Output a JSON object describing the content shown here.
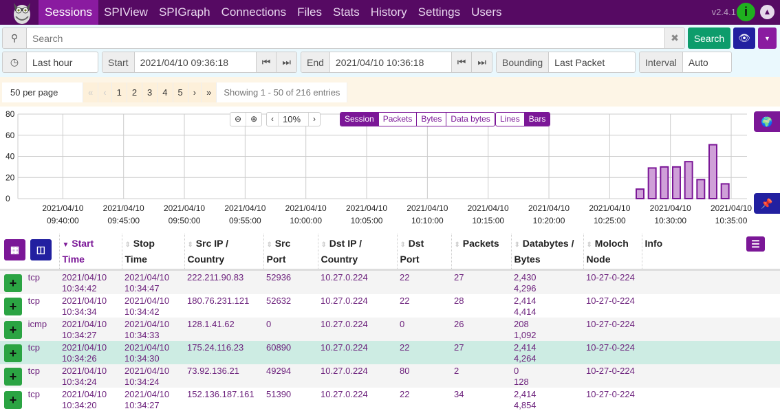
{
  "nav": {
    "items": [
      "Sessions",
      "SPIView",
      "SPIGraph",
      "Connections",
      "Files",
      "Stats",
      "History",
      "Settings",
      "Users"
    ],
    "active": "Sessions",
    "version": "v2.4.1"
  },
  "search": {
    "placeholder": "Search",
    "button": "Search"
  },
  "time": {
    "range": "Last hour",
    "start_label": "Start",
    "start": "2021/04/10 09:36:18",
    "end_label": "End",
    "end": "2021/04/10 10:36:18",
    "bounding_label": "Bounding",
    "bounding": "Last Packet",
    "interval_label": "Interval",
    "interval": "Auto"
  },
  "pager": {
    "per_page": "50 per page",
    "first": "«",
    "prev": "‹",
    "pages": [
      "1",
      "2",
      "3",
      "4",
      "5"
    ],
    "next": "›",
    "last": "»",
    "showing": "Showing 1 - 50 of 216 entries"
  },
  "chart_toolbar": {
    "zoom": "10%",
    "types": [
      "Session",
      "Packets",
      "Bytes",
      "Data bytes"
    ],
    "active_type": "Session",
    "styles": [
      "Lines",
      "Bars"
    ],
    "active_style": "Bars"
  },
  "chart_data": {
    "type": "bar",
    "xlim": [
      "09:36:18",
      "10:36:18"
    ],
    "ylim": [
      0,
      80
    ],
    "yticks": [
      0,
      20,
      40,
      60,
      80
    ],
    "grid": true,
    "xticks": [
      {
        "t": "09:40",
        "date": "2021/04/10",
        "time": "09:40:00"
      },
      {
        "t": "09:45",
        "date": "2021/04/10",
        "time": "09:45:00"
      },
      {
        "t": "09:50",
        "date": "2021/04/10",
        "time": "09:50:00"
      },
      {
        "t": "09:55",
        "date": "2021/04/10",
        "time": "09:55:00"
      },
      {
        "t": "10:00",
        "date": "2021/04/10",
        "time": "10:00:00"
      },
      {
        "t": "10:05",
        "date": "2021/04/10",
        "time": "10:05:00"
      },
      {
        "t": "10:10",
        "date": "2021/04/10",
        "time": "10:10:00"
      },
      {
        "t": "10:15",
        "date": "2021/04/10",
        "time": "10:15:00"
      },
      {
        "t": "10:20",
        "date": "2021/04/10",
        "time": "10:20:00"
      },
      {
        "t": "10:25",
        "date": "2021/04/10",
        "time": "10:25:00"
      },
      {
        "t": "10:30",
        "date": "2021/04/10",
        "time": "10:30:00"
      },
      {
        "t": "10:35",
        "date": "2021/04/10",
        "time": "10:35:00"
      }
    ],
    "x": [
      "10:27",
      "10:28",
      "10:29",
      "10:30",
      "10:31",
      "10:32",
      "10:33",
      "10:34"
    ],
    "values": [
      9,
      29,
      30,
      30,
      35,
      18,
      51,
      14
    ],
    "color": "#7b1797"
  },
  "table": {
    "headers": [
      [
        "Start",
        "Time"
      ],
      [
        "Stop",
        "Time"
      ],
      [
        "Src IP /",
        "Country"
      ],
      [
        "Src",
        "Port"
      ],
      [
        "Dst IP /",
        "Country"
      ],
      [
        "Dst",
        "Port"
      ],
      [
        "Packets",
        ""
      ],
      [
        "Databytes /",
        "Bytes"
      ],
      [
        "Moloch",
        "Node"
      ],
      [
        "Info",
        ""
      ]
    ],
    "rows": [
      [
        "tcp",
        "2021/04/10",
        "10:34:42",
        "2021/04/10",
        "10:34:47",
        "222.211.90.83",
        "52936",
        "10.27.0.224",
        "22",
        "27",
        "2,430",
        "4,296",
        "10-27-0-224"
      ],
      [
        "tcp",
        "2021/04/10",
        "10:34:34",
        "2021/04/10",
        "10:34:42",
        "180.76.231.121",
        "52632",
        "10.27.0.224",
        "22",
        "28",
        "2,414",
        "4,414",
        "10-27-0-224"
      ],
      [
        "icmp",
        "2021/04/10",
        "10:34:27",
        "2021/04/10",
        "10:34:33",
        "128.1.41.62",
        "0",
        "10.27.0.224",
        "0",
        "26",
        "208",
        "1,092",
        "10-27-0-224"
      ],
      [
        "tcp",
        "2021/04/10",
        "10:34:26",
        "2021/04/10",
        "10:34:30",
        "175.24.116.23",
        "60890",
        "10.27.0.224",
        "22",
        "27",
        "2,414",
        "4,264",
        "10-27-0-224"
      ],
      [
        "tcp",
        "2021/04/10",
        "10:34:24",
        "2021/04/10",
        "10:34:24",
        "73.92.136.21",
        "49294",
        "10.27.0.224",
        "80",
        "2",
        "0",
        "128",
        "10-27-0-224"
      ],
      [
        "tcp",
        "2021/04/10",
        "10:34:20",
        "2021/04/10",
        "10:34:27",
        "152.136.187.161",
        "51390",
        "10.27.0.224",
        "22",
        "34",
        "2,414",
        "4,854",
        "10-27-0-224"
      ]
    ]
  }
}
